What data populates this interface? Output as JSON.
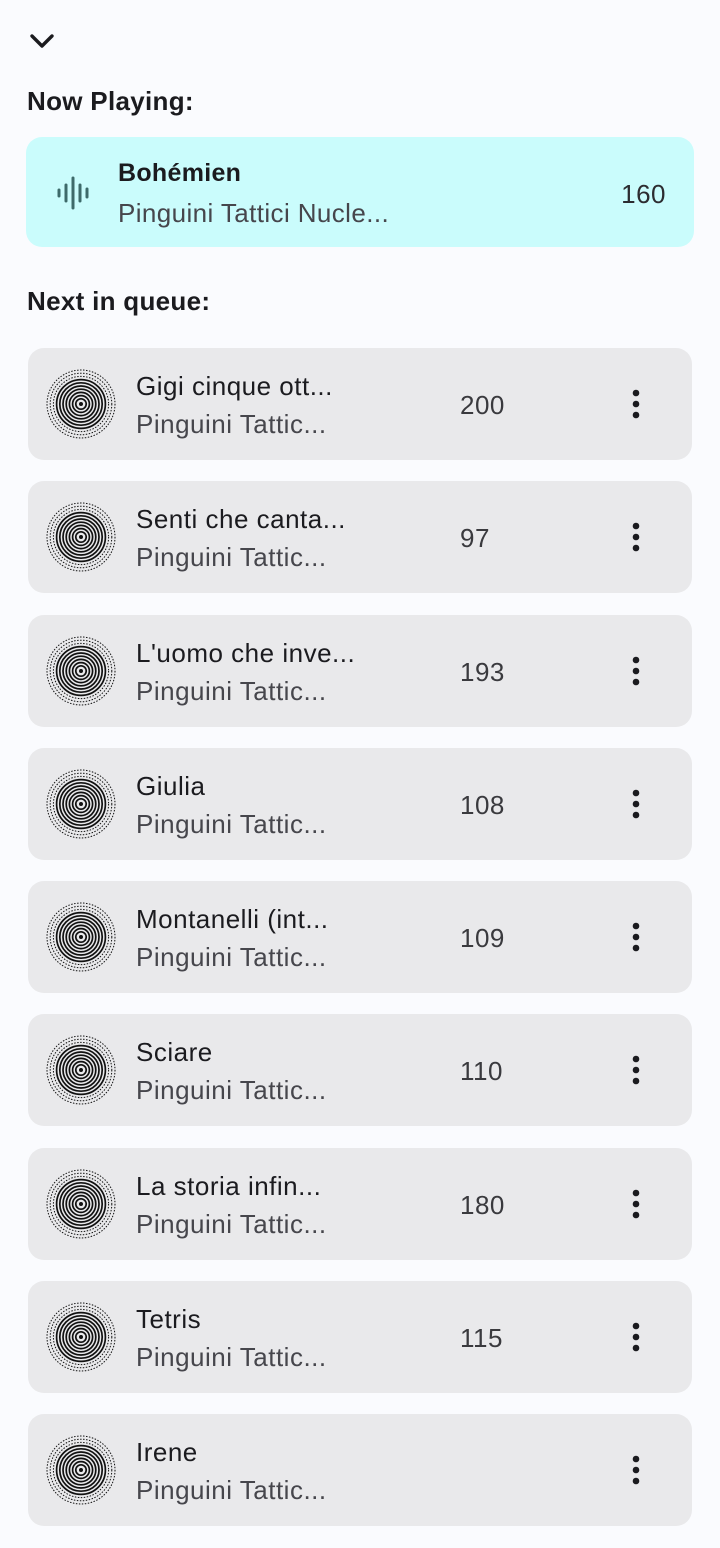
{
  "header": {
    "collapse_icon": "chevron-down-icon"
  },
  "now_playing": {
    "section_title": "Now Playing:",
    "icon": "sound-wave-icon",
    "title": "Bohémien",
    "artist": "Pinguini Tattici Nucle...",
    "number": "160",
    "background_color": "#cafcfc"
  },
  "queue": {
    "section_title": "Next in queue:",
    "item_background_color": "#e9e9eb",
    "menu_icon": "more-vertical-icon",
    "art_icon": "concentric-circles-art-icon",
    "items": [
      {
        "title": "Gigi cinque ott...",
        "artist": "Pinguini Tattic...",
        "number": "200"
      },
      {
        "title": "Senti che canta...",
        "artist": "Pinguini Tattic...",
        "number": "97"
      },
      {
        "title": "L'uomo che inve...",
        "artist": "Pinguini Tattic...",
        "number": "193"
      },
      {
        "title": "Giulia",
        "artist": "Pinguini Tattic...",
        "number": "108"
      },
      {
        "title": "Montanelli (int...",
        "artist": "Pinguini Tattic...",
        "number": "109"
      },
      {
        "title": "Sciare",
        "artist": "Pinguini Tattic...",
        "number": "110"
      },
      {
        "title": "La storia infin...",
        "artist": "Pinguini Tattic...",
        "number": "180"
      },
      {
        "title": "Tetris",
        "artist": "Pinguini Tattic...",
        "number": "115"
      },
      {
        "title": "Irene",
        "artist": "Pinguini Tattic...",
        "number": ""
      }
    ]
  }
}
